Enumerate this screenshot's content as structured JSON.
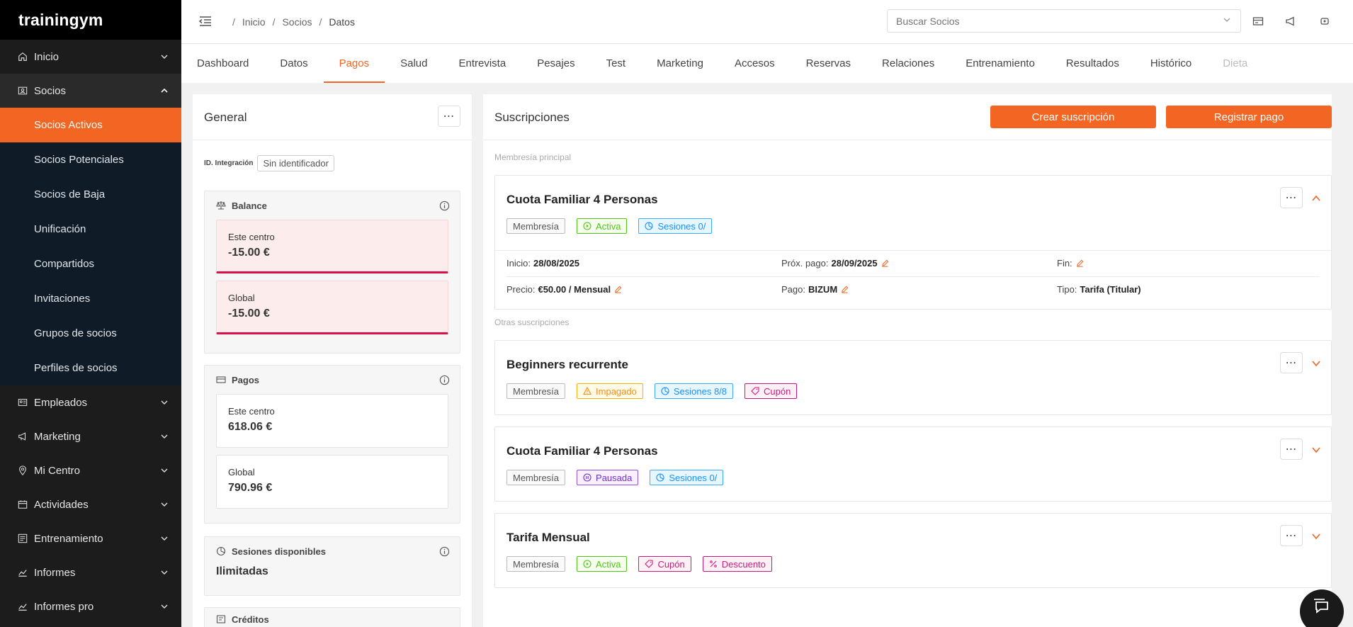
{
  "app": {
    "logo": "trainingym"
  },
  "sidebar": {
    "items": [
      {
        "label": "Inicio",
        "icon": "home-icon"
      },
      {
        "label": "Socios",
        "icon": "members-icon"
      },
      {
        "label": "Empleados",
        "icon": "employees-icon"
      },
      {
        "label": "Marketing",
        "icon": "megaphone-icon"
      },
      {
        "label": "Mi Centro",
        "icon": "location-icon"
      },
      {
        "label": "Actividades",
        "icon": "calendar-icon"
      },
      {
        "label": "Entrenamiento",
        "icon": "training-icon"
      },
      {
        "label": "Informes",
        "icon": "chart-line-icon"
      },
      {
        "label": "Informes pro",
        "icon": "chart-line-icon"
      }
    ],
    "socios_sub": [
      "Socios Activos",
      "Socios Potenciales",
      "Socios de Baja",
      "Unificación",
      "Compartidos",
      "Invitaciones",
      "Grupos de socios",
      "Perfiles de socios"
    ]
  },
  "topbar": {
    "breadcrumb": [
      "Inicio",
      "Socios",
      "Datos"
    ],
    "search_placeholder": "Buscar Socios"
  },
  "tabs": [
    "Dashboard",
    "Datos",
    "Pagos",
    "Salud",
    "Entrevista",
    "Pesajes",
    "Test",
    "Marketing",
    "Accesos",
    "Reservas",
    "Relaciones",
    "Entrenamiento",
    "Resultados",
    "Histórico",
    "Dieta"
  ],
  "general": {
    "title": "General",
    "id_label": "ID. Integración",
    "id_value": "Sin identificador",
    "balance": {
      "title": "Balance",
      "centro_label": "Este centro",
      "centro_value": "-15.00 €",
      "global_label": "Global",
      "global_value": "-15.00 €"
    },
    "pagos": {
      "title": "Pagos",
      "centro_label": "Este centro",
      "centro_value": "618.06 €",
      "global_label": "Global",
      "global_value": "790.96 €"
    },
    "sesiones": {
      "title": "Sesiones disponibles",
      "value": "Ilimitadas"
    },
    "creditos": {
      "title": "Créditos"
    }
  },
  "subs": {
    "title": "Suscripciones",
    "create_btn": "Crear suscripción",
    "pay_btn": "Registrar pago",
    "main_label": "Membresía principal",
    "other_label": "Otras suscripciones",
    "main": {
      "name": "Cuota Familiar 4 Personas",
      "badges": [
        "Membresía",
        "Activa",
        "Sesiones 0/"
      ],
      "inicio_label": "Inicio:",
      "inicio_value": "28/08/2025",
      "prox_label": "Próx. pago:",
      "prox_value": "28/09/2025",
      "fin_label": "Fin:",
      "precio_label": "Precio:",
      "precio_value": "€50.00 / Mensual",
      "pago_label": "Pago:",
      "pago_value": "BIZUM",
      "tipo_label": "Tipo:",
      "tipo_value": "Tarifa (Titular)"
    },
    "others": [
      {
        "name": "Beginners recurrente",
        "badges": [
          "Membresía",
          "Impagado",
          "Sesiones 8/8",
          "Cupón"
        ]
      },
      {
        "name": "Cuota Familiar 4 Personas",
        "badges": [
          "Membresía",
          "Pausada",
          "Sesiones 0/"
        ]
      },
      {
        "name": "Tarifa Mensual",
        "badges": [
          "Membresía",
          "Activa",
          "Cupón",
          "Descuento"
        ]
      }
    ]
  }
}
